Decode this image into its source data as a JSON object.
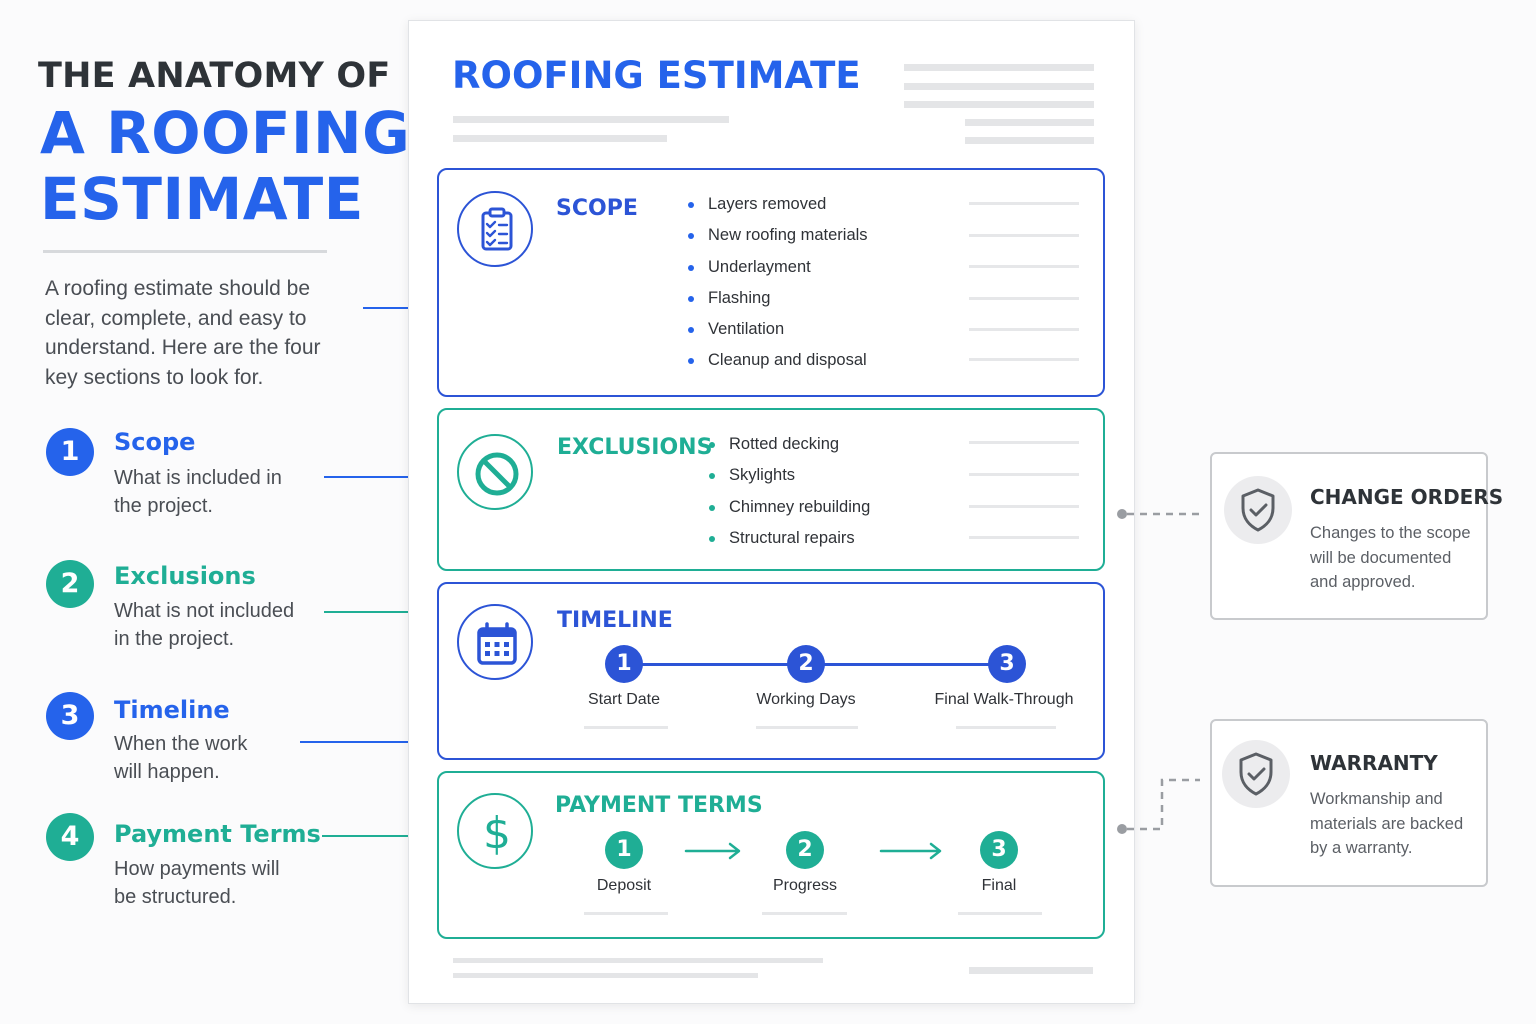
{
  "left": {
    "heading_line1": "THE ANATOMY OF",
    "heading_line2": "A ROOFING",
    "heading_line3": "ESTIMATE",
    "intro": "A roofing estimate should be clear, complete, and easy to understand. Here are the four key sections to look for.",
    "steps": [
      {
        "num": "1",
        "title": "Scope",
        "desc": "What is included in the project."
      },
      {
        "num": "2",
        "title": "Exclusions",
        "desc": "What is not included in the project."
      },
      {
        "num": "3",
        "title": "Timeline",
        "desc": "When the work will happen."
      },
      {
        "num": "4",
        "title": "Payment Terms",
        "desc": "How payments will be structured."
      }
    ]
  },
  "document": {
    "title": "ROOFING ESTIMATE",
    "scope": {
      "heading": "SCOPE",
      "items": [
        "Layers removed",
        "New roofing materials",
        "Underlayment",
        "Flashing",
        "Ventilation",
        "Cleanup and disposal"
      ]
    },
    "exclusions": {
      "heading": "EXCLUSIONS",
      "items": [
        "Rotted decking",
        "Skylights",
        "Chimney rebuilding",
        "Structural repairs"
      ]
    },
    "timeline": {
      "heading": "TIMELINE",
      "steps": [
        {
          "num": "1",
          "label": "Start Date"
        },
        {
          "num": "2",
          "label": "Working Days"
        },
        {
          "num": "3",
          "label": "Final Walk-Through"
        }
      ]
    },
    "payment": {
      "heading": "PAYMENT TERMS",
      "steps": [
        {
          "num": "1",
          "label": "Deposit"
        },
        {
          "num": "2",
          "label": "Progress"
        },
        {
          "num": "3",
          "label": "Final"
        }
      ]
    }
  },
  "side": {
    "change_orders": {
      "title": "CHANGE ORDERS",
      "desc": "Changes to the scope will be documented and approved."
    },
    "warranty": {
      "title": "WARRANTY",
      "desc": "Workmanship and materials are backed by a warranty."
    }
  },
  "colors": {
    "blue": "#2563eb",
    "teal": "#1fae95",
    "gray": "#c8cacd"
  },
  "icons": [
    "clipboard-checklist-icon",
    "prohibited-icon",
    "calendar-icon",
    "dollar-icon",
    "shield-check-icon"
  ]
}
